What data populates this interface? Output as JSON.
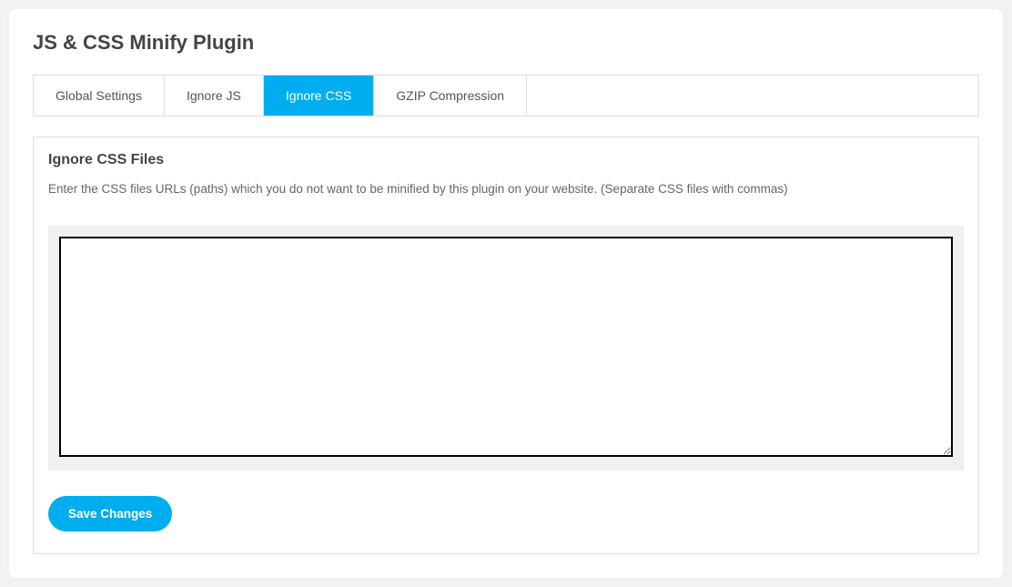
{
  "header": {
    "title": "JS & CSS Minify Plugin"
  },
  "tabs": [
    {
      "label": "Global Settings",
      "active": false
    },
    {
      "label": "Ignore JS",
      "active": false
    },
    {
      "label": "Ignore CSS",
      "active": true
    },
    {
      "label": "GZIP Compression",
      "active": false
    }
  ],
  "panel": {
    "section_title": "Ignore CSS Files",
    "description": "Enter the CSS files URLs (paths) which you do not want to be minified by this plugin on your website. (Separate CSS files with commas)",
    "textarea_value": "",
    "save_button_label": "Save Changes"
  }
}
